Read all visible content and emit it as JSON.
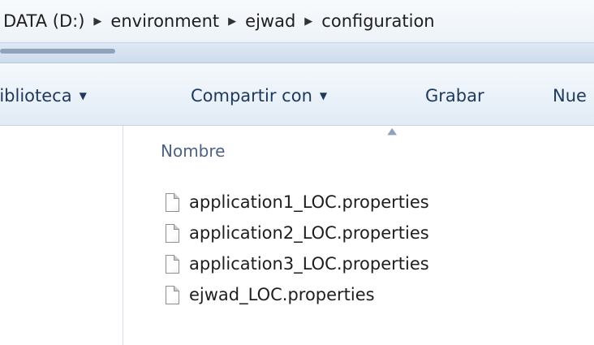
{
  "address_bar": {
    "breadcrumbs": [
      "DATA (D:)",
      "environment",
      "ejwad",
      "configuration"
    ],
    "separator_icon": "chevron-right-icon"
  },
  "toolbar": {
    "library_label": "biblioteca",
    "share_label": "Compartir con",
    "burn_label": "Grabar",
    "new_folder_label": "Nue",
    "dropdown_icon": "caret-down-icon"
  },
  "file_list": {
    "column_name": "Nombre",
    "sort_icon": "sort-ascending-icon",
    "files": [
      {
        "name": "application1_LOC.properties",
        "icon": "file-icon"
      },
      {
        "name": "application2_LOC.properties",
        "icon": "file-icon"
      },
      {
        "name": "application3_LOC.properties",
        "icon": "file-icon"
      },
      {
        "name": "ejwad_LOC.properties",
        "icon": "file-icon"
      }
    ]
  },
  "colors": {
    "command_text": "#1e395b",
    "header_text": "#4d6185",
    "address_bg": "#eef3f9"
  }
}
